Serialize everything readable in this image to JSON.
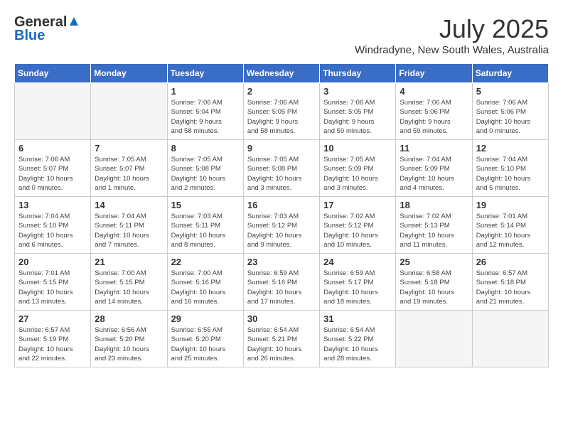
{
  "header": {
    "logo_general": "General",
    "logo_blue": "Blue",
    "month_title": "July 2025",
    "location": "Windradyne, New South Wales, Australia"
  },
  "weekdays": [
    "Sunday",
    "Monday",
    "Tuesday",
    "Wednesday",
    "Thursday",
    "Friday",
    "Saturday"
  ],
  "weeks": [
    [
      {
        "day": "",
        "info": ""
      },
      {
        "day": "",
        "info": ""
      },
      {
        "day": "1",
        "info": "Sunrise: 7:06 AM\nSunset: 5:04 PM\nDaylight: 9 hours\nand 58 minutes."
      },
      {
        "day": "2",
        "info": "Sunrise: 7:06 AM\nSunset: 5:05 PM\nDaylight: 9 hours\nand 58 minutes."
      },
      {
        "day": "3",
        "info": "Sunrise: 7:06 AM\nSunset: 5:05 PM\nDaylight: 9 hours\nand 59 minutes."
      },
      {
        "day": "4",
        "info": "Sunrise: 7:06 AM\nSunset: 5:06 PM\nDaylight: 9 hours\nand 59 minutes."
      },
      {
        "day": "5",
        "info": "Sunrise: 7:06 AM\nSunset: 5:06 PM\nDaylight: 10 hours\nand 0 minutes."
      }
    ],
    [
      {
        "day": "6",
        "info": "Sunrise: 7:06 AM\nSunset: 5:07 PM\nDaylight: 10 hours\nand 0 minutes."
      },
      {
        "day": "7",
        "info": "Sunrise: 7:05 AM\nSunset: 5:07 PM\nDaylight: 10 hours\nand 1 minute."
      },
      {
        "day": "8",
        "info": "Sunrise: 7:05 AM\nSunset: 5:08 PM\nDaylight: 10 hours\nand 2 minutes."
      },
      {
        "day": "9",
        "info": "Sunrise: 7:05 AM\nSunset: 5:08 PM\nDaylight: 10 hours\nand 3 minutes."
      },
      {
        "day": "10",
        "info": "Sunrise: 7:05 AM\nSunset: 5:09 PM\nDaylight: 10 hours\nand 3 minutes."
      },
      {
        "day": "11",
        "info": "Sunrise: 7:04 AM\nSunset: 5:09 PM\nDaylight: 10 hours\nand 4 minutes."
      },
      {
        "day": "12",
        "info": "Sunrise: 7:04 AM\nSunset: 5:10 PM\nDaylight: 10 hours\nand 5 minutes."
      }
    ],
    [
      {
        "day": "13",
        "info": "Sunrise: 7:04 AM\nSunset: 5:10 PM\nDaylight: 10 hours\nand 6 minutes."
      },
      {
        "day": "14",
        "info": "Sunrise: 7:04 AM\nSunset: 5:11 PM\nDaylight: 10 hours\nand 7 minutes."
      },
      {
        "day": "15",
        "info": "Sunrise: 7:03 AM\nSunset: 5:11 PM\nDaylight: 10 hours\nand 8 minutes."
      },
      {
        "day": "16",
        "info": "Sunrise: 7:03 AM\nSunset: 5:12 PM\nDaylight: 10 hours\nand 9 minutes."
      },
      {
        "day": "17",
        "info": "Sunrise: 7:02 AM\nSunset: 5:12 PM\nDaylight: 10 hours\nand 10 minutes."
      },
      {
        "day": "18",
        "info": "Sunrise: 7:02 AM\nSunset: 5:13 PM\nDaylight: 10 hours\nand 11 minutes."
      },
      {
        "day": "19",
        "info": "Sunrise: 7:01 AM\nSunset: 5:14 PM\nDaylight: 10 hours\nand 12 minutes."
      }
    ],
    [
      {
        "day": "20",
        "info": "Sunrise: 7:01 AM\nSunset: 5:15 PM\nDaylight: 10 hours\nand 13 minutes."
      },
      {
        "day": "21",
        "info": "Sunrise: 7:00 AM\nSunset: 5:15 PM\nDaylight: 10 hours\nand 14 minutes."
      },
      {
        "day": "22",
        "info": "Sunrise: 7:00 AM\nSunset: 5:16 PM\nDaylight: 10 hours\nand 16 minutes."
      },
      {
        "day": "23",
        "info": "Sunrise: 6:59 AM\nSunset: 5:16 PM\nDaylight: 10 hours\nand 17 minutes."
      },
      {
        "day": "24",
        "info": "Sunrise: 6:59 AM\nSunset: 5:17 PM\nDaylight: 10 hours\nand 18 minutes."
      },
      {
        "day": "25",
        "info": "Sunrise: 6:58 AM\nSunset: 5:18 PM\nDaylight: 10 hours\nand 19 minutes."
      },
      {
        "day": "26",
        "info": "Sunrise: 6:57 AM\nSunset: 5:18 PM\nDaylight: 10 hours\nand 21 minutes."
      }
    ],
    [
      {
        "day": "27",
        "info": "Sunrise: 6:57 AM\nSunset: 5:19 PM\nDaylight: 10 hours\nand 22 minutes."
      },
      {
        "day": "28",
        "info": "Sunrise: 6:56 AM\nSunset: 5:20 PM\nDaylight: 10 hours\nand 23 minutes."
      },
      {
        "day": "29",
        "info": "Sunrise: 6:55 AM\nSunset: 5:20 PM\nDaylight: 10 hours\nand 25 minutes."
      },
      {
        "day": "30",
        "info": "Sunrise: 6:54 AM\nSunset: 5:21 PM\nDaylight: 10 hours\nand 26 minutes."
      },
      {
        "day": "31",
        "info": "Sunrise: 6:54 AM\nSunset: 5:22 PM\nDaylight: 10 hours\nand 28 minutes."
      },
      {
        "day": "",
        "info": ""
      },
      {
        "day": "",
        "info": ""
      }
    ]
  ]
}
